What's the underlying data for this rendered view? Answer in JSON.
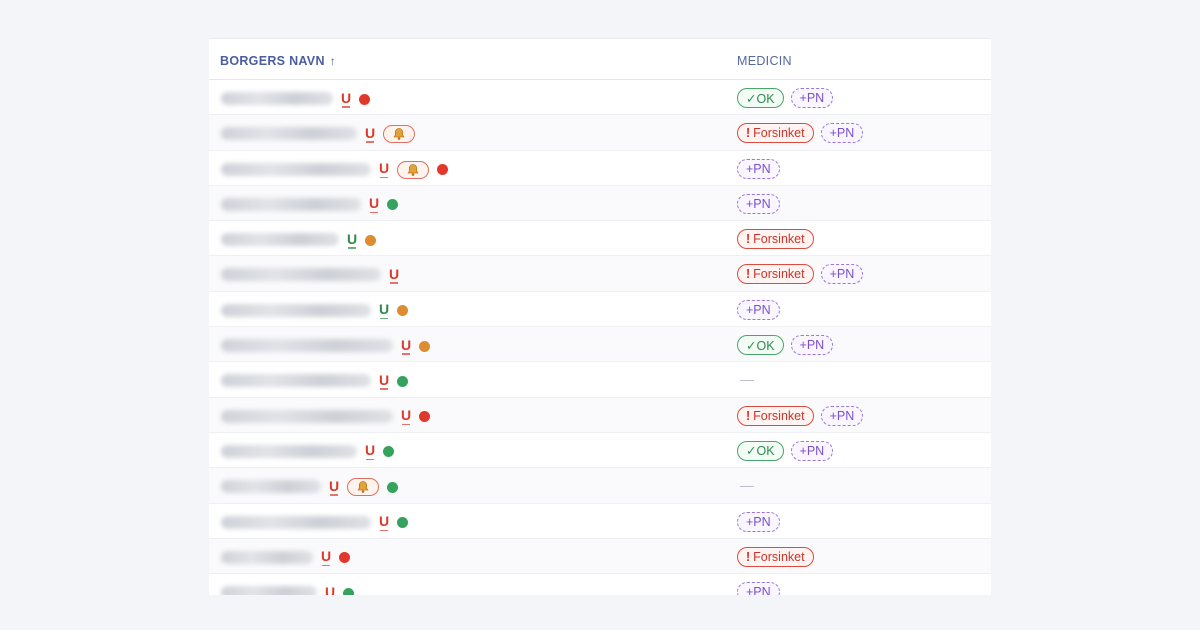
{
  "table": {
    "columns": {
      "name": "BORGERS NAVN",
      "sort_arrow": "↑",
      "medicine": "MEDICIN"
    },
    "labels": {
      "ok": "✓OK",
      "late_mark": "!",
      "late": "Forsinket",
      "pn": "+PN",
      "none": "—"
    },
    "colors": {
      "red": "#e0392b",
      "green": "#35a25d",
      "orange": "#dd8c30",
      "pn": "#9a74e0"
    },
    "rows": [
      {
        "name_hidden": true,
        "u": "red",
        "bell": false,
        "dot": "red",
        "med": [
          "ok",
          "pn"
        ]
      },
      {
        "name_hidden": true,
        "u": "red",
        "bell": true,
        "dot": null,
        "med": [
          "late",
          "pn"
        ]
      },
      {
        "name_hidden": true,
        "u": "red",
        "bell": true,
        "dot": "red",
        "med": [
          "pn"
        ]
      },
      {
        "name_hidden": true,
        "u": "red",
        "bell": false,
        "dot": "green",
        "med": [
          "pn"
        ]
      },
      {
        "name_hidden": true,
        "u": "green",
        "bell": false,
        "dot": "orange",
        "med": [
          "late"
        ]
      },
      {
        "name_hidden": true,
        "u": "red",
        "bell": false,
        "dot": null,
        "med": [
          "late",
          "pn"
        ]
      },
      {
        "name_hidden": true,
        "u": "green",
        "bell": false,
        "dot": "orange",
        "med": [
          "pn"
        ]
      },
      {
        "name_hidden": true,
        "u": "red",
        "bell": false,
        "dot": "orange",
        "med": [
          "ok",
          "pn"
        ]
      },
      {
        "name_hidden": true,
        "u": "red",
        "bell": false,
        "dot": "green",
        "med": []
      },
      {
        "name_hidden": true,
        "u": "red",
        "bell": false,
        "dot": "red",
        "med": [
          "late",
          "pn"
        ]
      },
      {
        "name_hidden": true,
        "u": "red",
        "bell": false,
        "dot": "green",
        "med": [
          "ok",
          "pn"
        ]
      },
      {
        "name_hidden": true,
        "u": "red",
        "bell": true,
        "dot": "green",
        "med": []
      },
      {
        "name_hidden": true,
        "u": "red",
        "bell": false,
        "dot": "green",
        "med": [
          "pn"
        ]
      },
      {
        "name_hidden": true,
        "u": "red",
        "bell": false,
        "dot": "red",
        "med": [
          "late"
        ]
      },
      {
        "name_hidden": true,
        "u": "red",
        "bell": false,
        "dot": "green",
        "med": [
          "pn"
        ]
      }
    ]
  }
}
